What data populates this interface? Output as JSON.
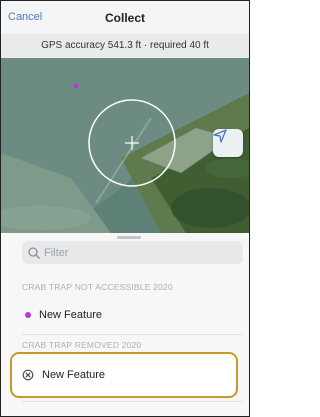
{
  "header": {
    "cancel_label": "Cancel",
    "title": "Collect"
  },
  "gps_status": "GPS accuracy 541.3 ft · required 40 ft",
  "map": {
    "locate_icon": "location-arrow-icon",
    "reticle_icon": "crosshair-icon"
  },
  "sheet": {
    "filter_placeholder": "Filter",
    "groups": [
      {
        "label": "CRAB TRAP NOT ACCESSIBLE 2020",
        "item_label": "New Feature",
        "symbol": "purple-dot",
        "symbol_color": "#b43ad6"
      },
      {
        "label": "CRAB TRAP REMOVED 2020",
        "item_label": "New Feature",
        "symbol": "x-circle-icon"
      }
    ]
  },
  "colors": {
    "accent": "#4a78b8",
    "highlight_border": "#c49a2a"
  }
}
